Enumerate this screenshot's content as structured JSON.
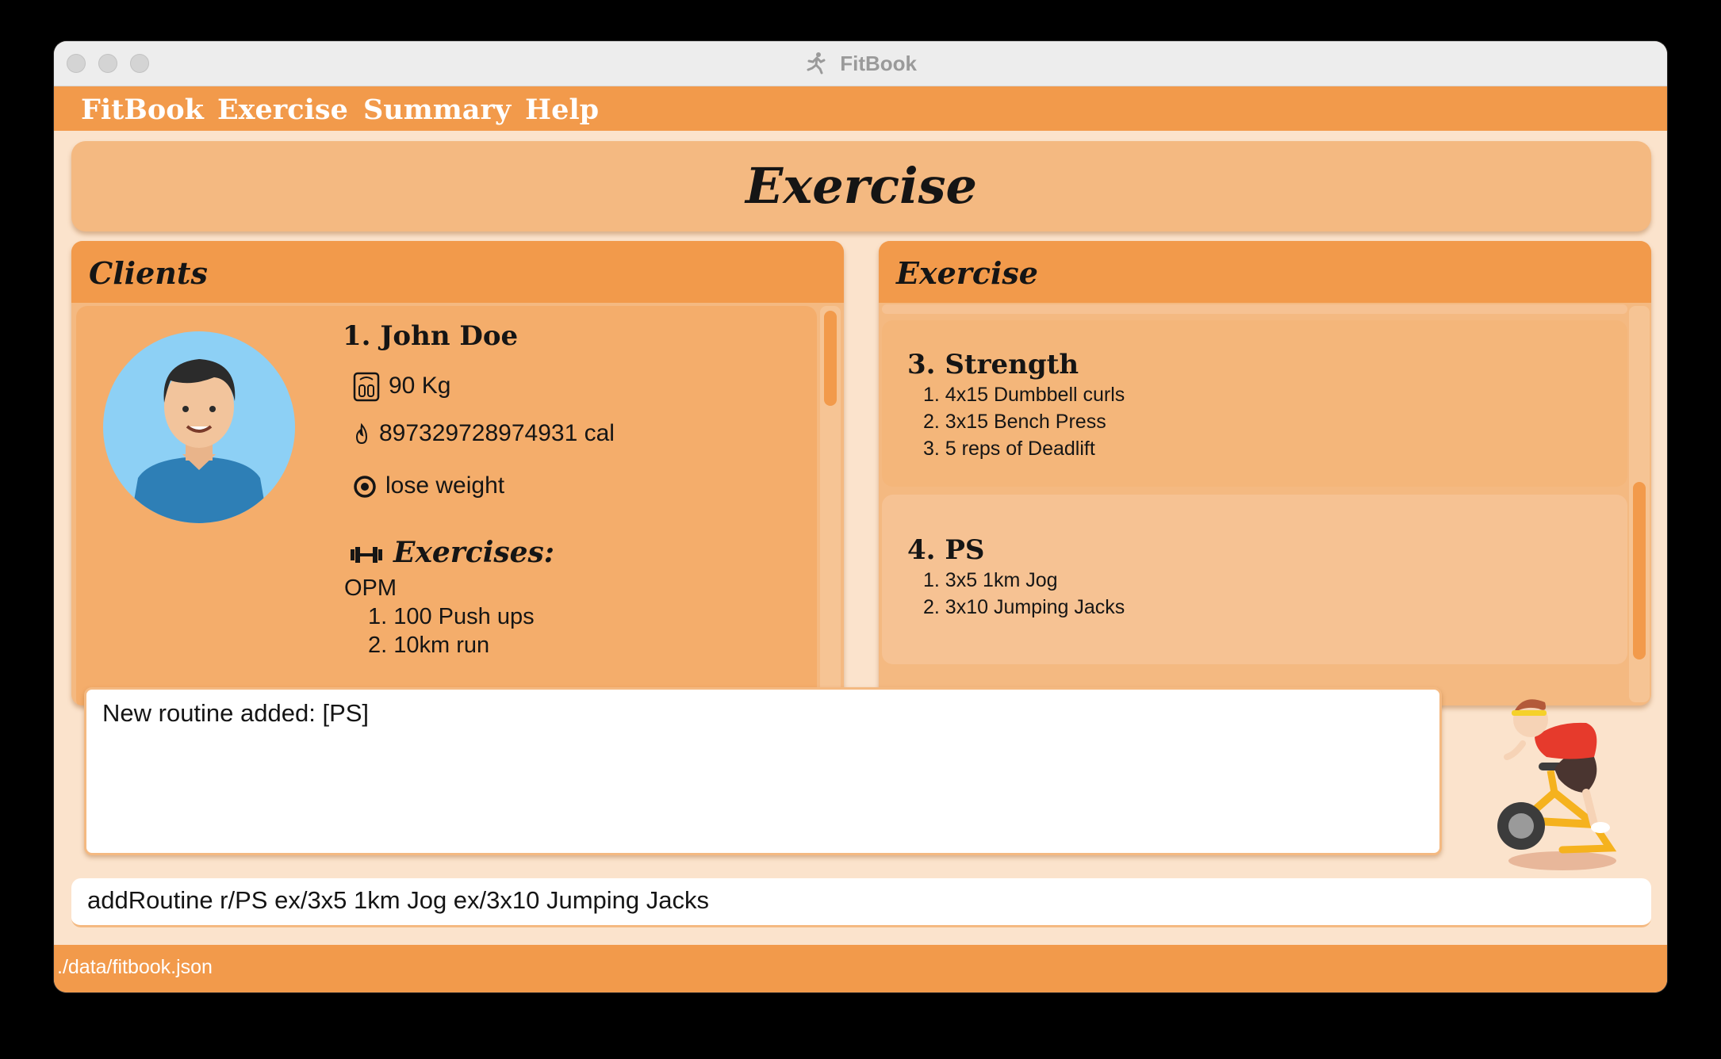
{
  "window": {
    "title": "FitBook"
  },
  "menu": {
    "items": [
      "FitBook",
      "Exercise",
      "Summary",
      "Help"
    ]
  },
  "header": {
    "title": "Exercise"
  },
  "clients_panel": {
    "title": "Clients",
    "client": {
      "index_name": "1.  John Doe",
      "weight": "90 Kg",
      "calories": "897329728974931 cal",
      "goal": "lose weight",
      "exercises_heading": "Exercises:",
      "routine_name": "OPM",
      "routine_items": [
        "1. 100 Push ups",
        "2. 10km run"
      ]
    }
  },
  "exercise_panel": {
    "title": "Exercise",
    "routines": [
      {
        "title": "3.  Strength",
        "items": [
          "1. 4x15 Dumbbell curls",
          "2. 3x15 Bench Press",
          "3. 5 reps of Deadlift"
        ]
      },
      {
        "title": "4.  PS",
        "items": [
          "1. 3x5 1km Jog",
          "2. 3x10 Jumping Jacks"
        ]
      }
    ]
  },
  "result": {
    "text": "New routine added: [PS]"
  },
  "command": {
    "value": "addRoutine r/PS ex/3x5 1km Jog ex/3x10 Jumping Jacks"
  },
  "status": {
    "path": "./data/fitbook.json"
  },
  "colors": {
    "accent": "#f29a4b",
    "panel": "#f4b981",
    "background": "#fbe3cc"
  }
}
